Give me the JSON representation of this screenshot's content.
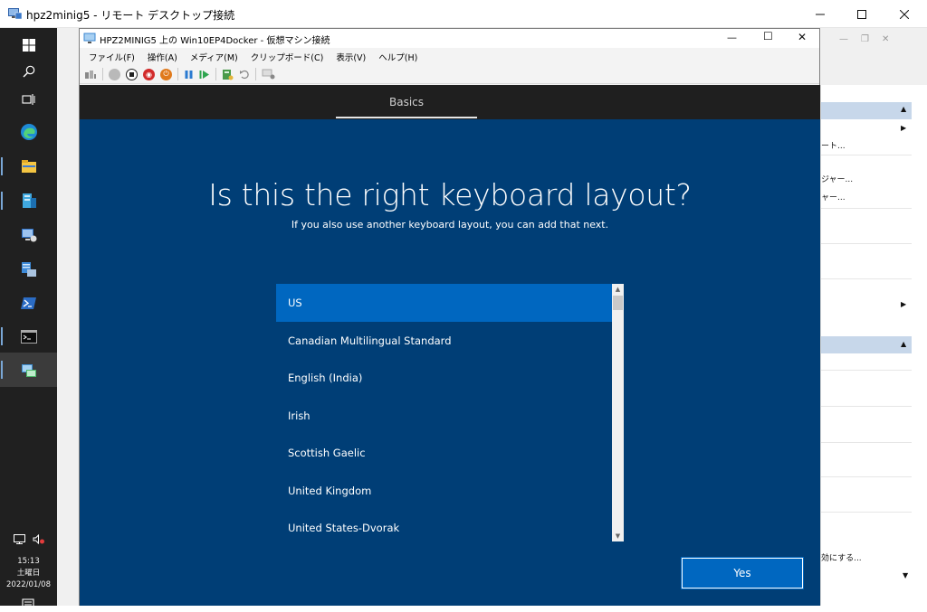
{
  "rdp": {
    "title": "hpz2minig5 - リモート デスクトップ接続",
    "minimize_icon": "minimize-icon",
    "maximize_icon": "maximize-icon",
    "close_icon": "close-icon"
  },
  "taskbar": {
    "items": [
      "windows-start-icon",
      "search-icon",
      "task-view-icon",
      "edge-icon",
      "file-explorer-icon",
      "server-manager-icon",
      "remote-desktop-icon",
      "windows-admin-center-icon",
      "powershell-icon",
      "command-prompt-icon",
      "hyper-v-manager-icon"
    ],
    "time": "15:13",
    "day": "土曜日",
    "date": "2022/01/08"
  },
  "vm": {
    "title": "HPZ2MINIG5 上の Win10EP4Docker - 仮想マシン接続",
    "menu": [
      "ファイル(F)",
      "操作(A)",
      "メディア(M)",
      "クリップボード(C)",
      "表示(V)",
      "ヘルプ(H)"
    ]
  },
  "host": {
    "partial_texts": [
      "ート...",
      "ジャー...",
      "ャー...",
      "効にする..."
    ]
  },
  "oobe": {
    "tab_label": "Basics",
    "heading": "Is this the right keyboard layout?",
    "subtitle": "If you also use another keyboard layout, you can add that next.",
    "layouts": [
      "US",
      "Canadian Multilingual Standard",
      "English (India)",
      "Irish",
      "Scottish Gaelic",
      "United Kingdom",
      "United States-Dvorak"
    ],
    "selected_layout": "US",
    "yes_label": "Yes"
  },
  "colors": {
    "oobe_background": "#003e76",
    "selection": "#0067c0",
    "header": "#1f1f1f",
    "taskbar": "#202020"
  }
}
